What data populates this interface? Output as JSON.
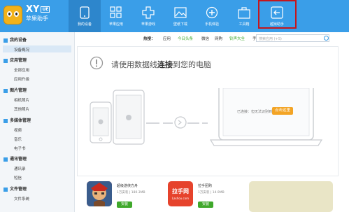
{
  "brand": {
    "name": "XY",
    "badge": "UE",
    "subtitle": "苹果助手"
  },
  "tabs": [
    {
      "label": "我的设备",
      "icon": "phone-icon"
    },
    {
      "label": "苹果应用",
      "icon": "apps-grid-icon"
    },
    {
      "label": "苹果游戏",
      "icon": "gamepad-icon"
    },
    {
      "label": "壁纸下载",
      "icon": "image-icon"
    },
    {
      "label": "手机体验",
      "icon": "plus-circle-icon"
    },
    {
      "label": "工具箱",
      "icon": "briefcase-icon"
    },
    {
      "label": "越狱助手",
      "icon": "exit-icon"
    }
  ],
  "sidebar": {
    "groups": [
      {
        "label": "我的设备",
        "items": [
          "设备概况"
        ]
      },
      {
        "label": "应用管理",
        "items": [
          "全部应用",
          "应用升级"
        ]
      },
      {
        "label": "图片管理",
        "items": [
          "相机照片",
          "其他照片"
        ]
      },
      {
        "label": "多媒体管理",
        "items": [
          "视频",
          "音乐",
          "电子书"
        ]
      },
      {
        "label": "通讯管理",
        "items": [
          "通讯录",
          "短信"
        ]
      },
      {
        "label": "文件管理",
        "items": [
          "文件系统"
        ]
      }
    ]
  },
  "hot": {
    "label": "热搜：",
    "items": [
      "应用",
      "今日头条",
      "微信",
      "网购",
      "铃声大全",
      "手电筒"
    ]
  },
  "search": {
    "placeholder": "搜索应用 (+S)"
  },
  "connect": {
    "pre": "请使用数据线",
    "bold": "连接",
    "post": "到您的电脑"
  },
  "status": {
    "text": "已连接：但无法识别到设备",
    "button": "点击这里"
  },
  "apps": [
    {
      "name": "超级游侠方舟",
      "meta": "1万安装 | 180.3MB",
      "button": "安装",
      "color": "#d1483b"
    },
    {
      "name": "拉手团购",
      "meta": "1万安装 | 14.9MB",
      "button": "安装",
      "color": "#e6432c",
      "logo": "拉手网",
      "logo_sub": "Lashou.com"
    },
    {
      "name": "",
      "meta": "",
      "button": "",
      "color": "#e4dfb8"
    }
  ]
}
